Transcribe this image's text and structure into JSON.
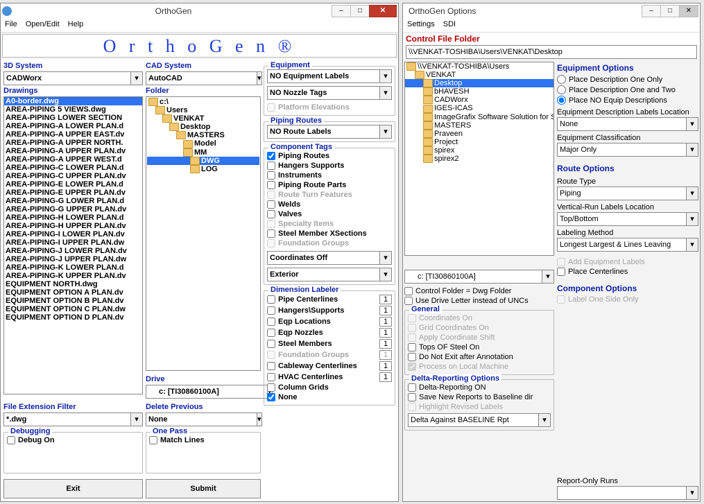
{
  "main": {
    "title": "OrthoGen",
    "menus": {
      "file": "File",
      "open_edit": "Open/Edit",
      "help": "Help"
    },
    "banner": "O r t h o   G e n ®",
    "threeD": {
      "label": "3D System",
      "value": "CADWorx"
    },
    "cad": {
      "label": "CAD System",
      "value": "AutoCAD"
    },
    "drawings_label": "Drawings",
    "drawings": [
      "A0-border.dwg",
      "AREA-PIPING 5 VIEWS.dwg",
      "AREA-PIPING LOWER SECTION",
      "AREA-PIPING-A LOWER PLAN.d",
      "AREA-PIPING-A UPPER EAST.dv",
      "AREA-PIPING-A UPPER NORTH.",
      "AREA-PIPING-A UPPER PLAN.dv",
      "AREA-PIPING-A UPPER WEST.d",
      "AREA-PIPING-C LOWER PLAN.d",
      "AREA-PIPING-C UPPER PLAN.dv",
      "AREA-PIPING-E LOWER PLAN.d",
      "AREA-PIPING-E UPPER PLAN.dv",
      "AREA-PIPING-G LOWER PLAN.d",
      "AREA-PIPING-G UPPER PLAN.dv",
      "AREA-PIPING-H LOWER PLAN.d",
      "AREA-PIPING-H UPPER PLAN.dv",
      "AREA-PIPING-I LOWER PLAN.dv",
      "AREA-PIPING-I UPPER PLAN.dw",
      "AREA-PIPING-J LOWER PLAN.dv",
      "AREA-PIPING-J UPPER PLAN.dw",
      "AREA-PIPING-K LOWER PLAN.d",
      "AREA-PIPING-K UPPER PLAN.dv",
      "EQUIPMENT NORTH.dwg",
      "EQUIPMENT OPTION A PLAN.dv",
      "EQUIPMENT OPTION B PLAN.dv",
      "EQUIPMENT OPTION C PLAN.dw",
      "EQUIPMENT OPTION D PLAN.dv"
    ],
    "folder_label": "Folder",
    "folder_tree": [
      "c:\\",
      "Users",
      "VENKAT",
      "Desktop",
      "MASTERS",
      "Model",
      "MM",
      "DWG",
      "LOG"
    ],
    "drive_label": "Drive",
    "drive_value": "c: [TI30860100A]",
    "filext_label": "File Extension Filter",
    "filext_value": "*.dwg",
    "delprev_label": "Delete Previous",
    "delprev_value": "None",
    "debugging_label": "Debugging",
    "debug_on": "Debug On",
    "onepass_label": "One Pass",
    "match_lines": "Match Lines",
    "exit_btn": "Exit",
    "submit_btn": "Submit",
    "equipment": {
      "label": "Equipment",
      "labels_value": "NO Equipment Labels",
      "nozzle_value": "NO Nozzle Tags",
      "platform": "Platform Elevations"
    },
    "piping_routes": {
      "label": "Piping Routes",
      "value": "NO Route Labels"
    },
    "comp_tags": {
      "label": "Component Tags",
      "items": [
        {
          "text": "Piping Routes",
          "checked": true,
          "disabled": false
        },
        {
          "text": "Hangers Supports",
          "checked": false,
          "disabled": false
        },
        {
          "text": "Instruments",
          "checked": false,
          "disabled": false
        },
        {
          "text": "Piping Route Parts",
          "checked": false,
          "disabled": false
        },
        {
          "text": "Route Turn Features",
          "checked": false,
          "disabled": true
        },
        {
          "text": "Welds",
          "checked": false,
          "disabled": false
        },
        {
          "text": "Valves",
          "checked": false,
          "disabled": false
        },
        {
          "text": "Specialty Items",
          "checked": false,
          "disabled": true
        },
        {
          "text": "Steel Member XSections",
          "checked": false,
          "disabled": false
        },
        {
          "text": "Foundation Groups",
          "checked": false,
          "disabled": true
        }
      ],
      "coords": "Coordinates Off",
      "exterior": "Exterior"
    },
    "dim_labeler": {
      "label": "Dimension Labeler",
      "rows": [
        {
          "text": "Pipe Centerlines",
          "n": "1"
        },
        {
          "text": "Hangers\\Supports",
          "n": "1"
        },
        {
          "text": "Eqp Locations",
          "n": "1"
        },
        {
          "text": "Eqp Nozzles",
          "n": "1"
        },
        {
          "text": "Steel Members",
          "n": "1"
        },
        {
          "text": "Foundation Groups",
          "n": "1",
          "disabled": true
        },
        {
          "text": "Cableway Centerlines",
          "n": "1"
        },
        {
          "text": "HVAC Centerlines",
          "n": "1"
        },
        {
          "text": "Column Grids"
        },
        {
          "text": "None",
          "checked": true
        }
      ]
    }
  },
  "opts": {
    "title": "OrthoGen  Options",
    "menus": {
      "settings": "Settings",
      "sdi": "SDI"
    },
    "cff_label": "Control File Folder",
    "cff_value": "\\\\VENKAT-TOSHIBA\\Users\\VENKAT\\Desktop",
    "tree": [
      "\\\\VENKAT-TOSHIBA\\Users",
      "VENKAT",
      "Desktop",
      "bHAVESH",
      "CADWorx",
      "IGES-ICAS",
      "ImageGrafix Software Solution for SKID",
      "MASTERS",
      "Praveen",
      "Project",
      "spirex",
      "spirex2"
    ],
    "drive_value": "c: [TI30860100A]",
    "cf_dwg": "Control Folder = Dwg Folder",
    "udl": "Use Drive Letter instead of UNCs",
    "general_label": "General",
    "general": [
      {
        "text": "Coordinates On",
        "disabled": true
      },
      {
        "text": "Grid Coordinates On",
        "disabled": true
      },
      {
        "text": "Apply Coordinate Shift",
        "disabled": true
      },
      {
        "text": "Tops OF Steel On"
      },
      {
        "text": "Do Not Exit after Annotation"
      },
      {
        "text": "Process on Local Machine",
        "disabled": true,
        "checked": true
      }
    ],
    "delta_label": "Delta-Reporting Options",
    "delta": [
      {
        "text": "Delta-Reporting ON"
      },
      {
        "text": "Save New Reports to Baseline dir"
      },
      {
        "text": "Highlight Revised Labels",
        "disabled": true
      }
    ],
    "delta_value": "Delta Against BASELINE Rpt",
    "eq_opts_label": "Equipment Options",
    "radios": [
      "Place Description One Only",
      "Place Description One and Two",
      "Place NO Equip Descriptions"
    ],
    "edl_label": "Equipment Description Labels Location",
    "edl_value": "None",
    "ec_label": "Equipment Classification",
    "ec_value": "Major Only",
    "route_opts_label": "Route Options",
    "route_type_label": "Route Type",
    "route_type_value": "Piping",
    "vrl_label": "Vertical-Run Labels Location",
    "vrl_value": "Top/Bottom",
    "lm_label": "Labeling Method",
    "lm_value": "Longest Largest & Lines Leaving",
    "ael": "Add Equipment Labels",
    "pc": "Place Centerlines",
    "co_label": "Component Options",
    "loso": "Label One Side Only",
    "ror_label": "Report-Only Runs"
  }
}
